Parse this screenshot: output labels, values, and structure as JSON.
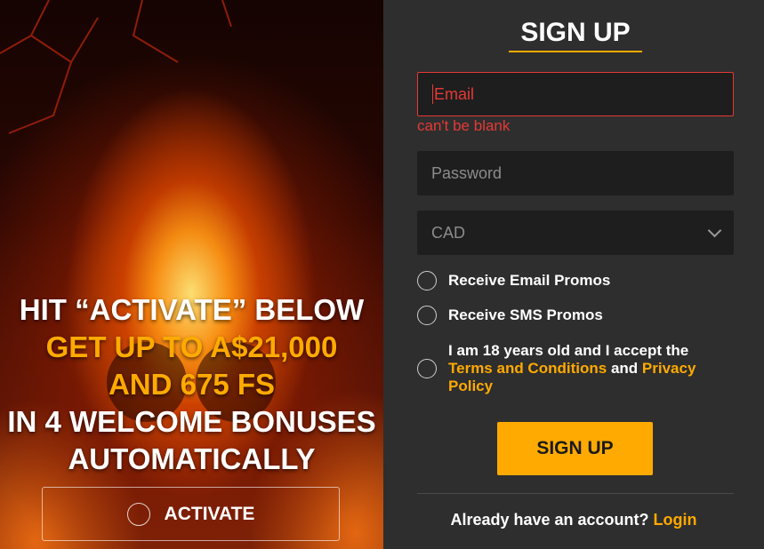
{
  "promo": {
    "line1": "HIT “ACTIVATE” BELOW",
    "line2": "GET UP TO A$21,000",
    "line3": "AND 675 FS",
    "line4": "IN 4 WELCOME BONUSES",
    "line5": "AUTOMATICALLY",
    "activate_label": "ACTIVATE"
  },
  "signup": {
    "title": "SIGN UP",
    "email_placeholder": "Email",
    "email_error": "can't be blank",
    "password_placeholder": "Password",
    "currency_value": "CAD",
    "email_promos_label": "Receive Email Promos",
    "sms_promos_label": "Receive SMS Promos",
    "terms_prefix": "I am 18 years old and I accept the",
    "terms_link": "Terms and Conditions",
    "terms_and": "and",
    "privacy_link": "Privacy Policy",
    "submit_label": "SIGN UP",
    "login_prompt": "Already have an account?",
    "login_link": "Login"
  },
  "colors": {
    "accent": "#ffaa00",
    "error": "#e53935",
    "panel": "#2e2e2e",
    "field": "#1e1e1e"
  },
  "icons": [
    "chevron-down-icon",
    "radio-icon"
  ]
}
